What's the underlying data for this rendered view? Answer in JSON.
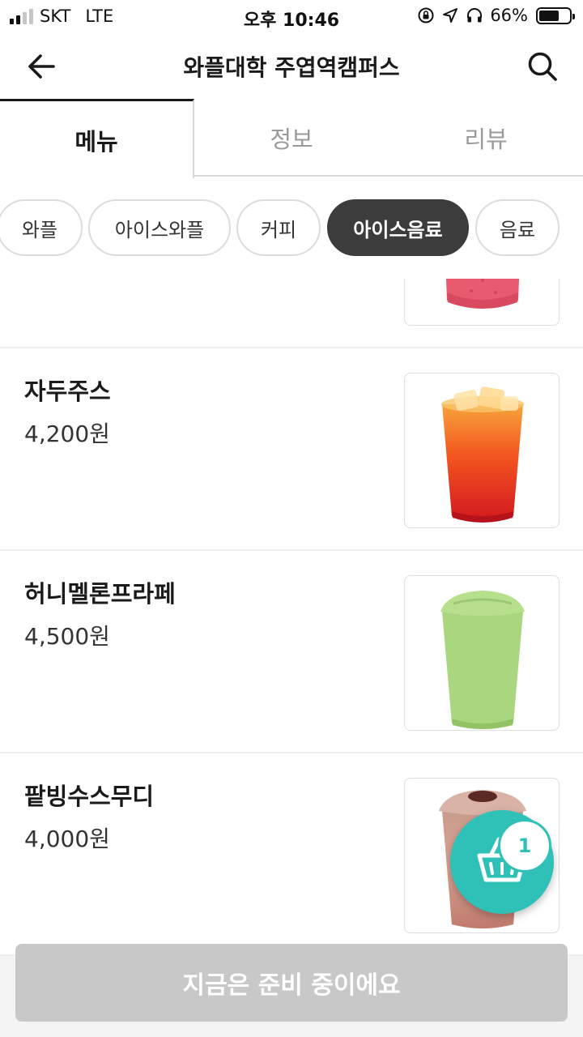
{
  "status_bar": {
    "carrier": "SKT",
    "network": "LTE",
    "time": "오후 10:46",
    "battery_percent": "66%",
    "battery_level": 0.66
  },
  "header": {
    "title": "와플대학 주엽역캠퍼스"
  },
  "tabs": [
    {
      "label": "메뉴",
      "active": true
    },
    {
      "label": "정보",
      "active": false
    },
    {
      "label": "리뷰",
      "active": false
    }
  ],
  "categories": [
    {
      "label": "와플",
      "active": false
    },
    {
      "label": "아이스와플",
      "active": false
    },
    {
      "label": "커피",
      "active": false
    },
    {
      "label": "아이스음료",
      "active": true
    },
    {
      "label": "음료",
      "active": false
    }
  ],
  "menu_items": [
    {
      "name": "자두주스",
      "price": "4,200원",
      "image": "plum-juice-cup"
    },
    {
      "name": "허니멜론프라페",
      "price": "4,500원",
      "image": "melon-frappe-cup"
    },
    {
      "name": "팥빙수스무디",
      "price": "4,000원",
      "image": "redbean-smoothie-cup"
    }
  ],
  "cart": {
    "count": "1"
  },
  "order_button": {
    "label": "지금은 준비 중이에요"
  },
  "colors": {
    "accent": "#2fc1b7",
    "active_chip": "#3c3c3c",
    "disabled_button": "#c8c8c8"
  }
}
